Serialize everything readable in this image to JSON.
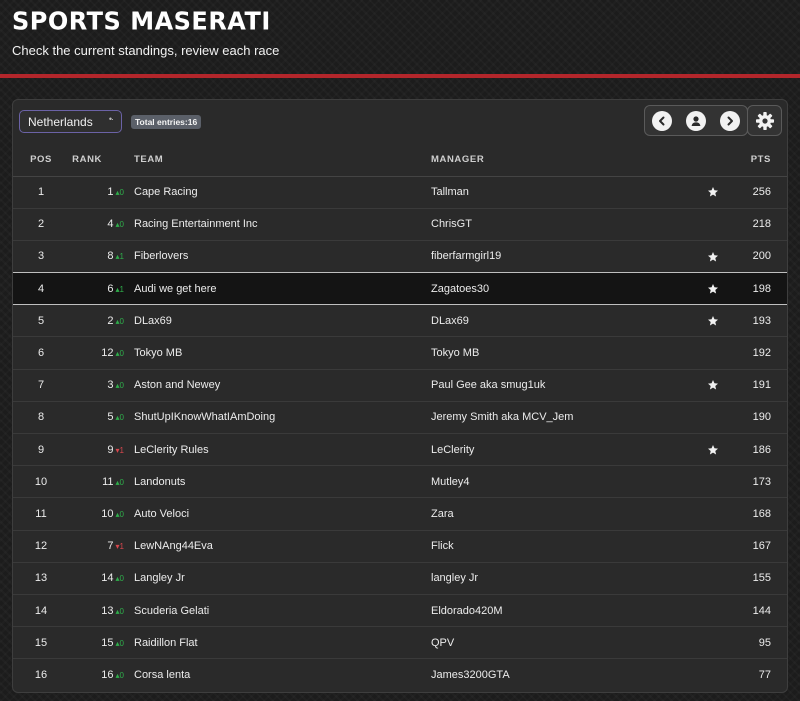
{
  "header": {
    "title": "SPORTS MASERATI",
    "subtitle": "Check the current standings, review each race"
  },
  "toolbar": {
    "country": "Netherlands",
    "total_entries_label": "Total entries:16"
  },
  "columns": {
    "pos": "POS",
    "rank": "RANK",
    "team": "TEAM",
    "manager": "MANAGER",
    "pts": "PTS"
  },
  "colors": {
    "accent_red": "#b3262b",
    "select_border": "#6b62a6",
    "up": "#2fae4b",
    "down": "#d8474d"
  },
  "rows": [
    {
      "pos": "1",
      "rank": "1",
      "delta": "0",
      "dir": "up",
      "team": "Cape Racing",
      "manager": "Tallman",
      "starred": true,
      "pts": "256"
    },
    {
      "pos": "2",
      "rank": "4",
      "delta": "0",
      "dir": "up",
      "team": "Racing Entertainment Inc",
      "manager": "ChrisGT",
      "starred": false,
      "pts": "218"
    },
    {
      "pos": "3",
      "rank": "8",
      "delta": "1",
      "dir": "up",
      "team": "Fiberlovers",
      "manager": "fiberfarmgirl19",
      "starred": true,
      "pts": "200"
    },
    {
      "pos": "4",
      "rank": "6",
      "delta": "1",
      "dir": "up",
      "team": "Audi we get here",
      "manager": "Zagatoes30",
      "starred": true,
      "pts": "198",
      "selected": true
    },
    {
      "pos": "5",
      "rank": "2",
      "delta": "0",
      "dir": "up",
      "team": "DLax69",
      "manager": "DLax69",
      "starred": true,
      "pts": "193"
    },
    {
      "pos": "6",
      "rank": "12",
      "delta": "0",
      "dir": "up",
      "team": "Tokyo MB",
      "manager": "Tokyo MB",
      "starred": false,
      "pts": "192"
    },
    {
      "pos": "7",
      "rank": "3",
      "delta": "0",
      "dir": "up",
      "team": "Aston and Newey",
      "manager": "Paul Gee aka smug1uk",
      "starred": true,
      "pts": "191"
    },
    {
      "pos": "8",
      "rank": "5",
      "delta": "0",
      "dir": "up",
      "team": "ShutUpIKnowWhatIAmDoing",
      "manager": "Jeremy Smith aka MCV_Jem",
      "starred": false,
      "pts": "190"
    },
    {
      "pos": "9",
      "rank": "9",
      "delta": "1",
      "dir": "down",
      "team": "LeClerity Rules",
      "manager": "LeClerity",
      "starred": true,
      "pts": "186"
    },
    {
      "pos": "10",
      "rank": "11",
      "delta": "0",
      "dir": "up",
      "team": "Landonuts",
      "manager": "Mutley4",
      "starred": false,
      "pts": "173"
    },
    {
      "pos": "11",
      "rank": "10",
      "delta": "0",
      "dir": "up",
      "team": "Auto Veloci",
      "manager": "Zara",
      "starred": false,
      "pts": "168"
    },
    {
      "pos": "12",
      "rank": "7",
      "delta": "1",
      "dir": "down",
      "team": "LewNAng44Eva",
      "manager": "Flick",
      "starred": false,
      "pts": "167"
    },
    {
      "pos": "13",
      "rank": "14",
      "delta": "0",
      "dir": "up",
      "team": "Langley Jr",
      "manager": "langley Jr",
      "starred": false,
      "pts": "155"
    },
    {
      "pos": "14",
      "rank": "13",
      "delta": "0",
      "dir": "up",
      "team": "Scuderia Gelati",
      "manager": "Eldorado420M",
      "starred": false,
      "pts": "144"
    },
    {
      "pos": "15",
      "rank": "15",
      "delta": "0",
      "dir": "up",
      "team": "Raidillon Flat",
      "manager": "QPV",
      "starred": false,
      "pts": "95"
    },
    {
      "pos": "16",
      "rank": "16",
      "delta": "0",
      "dir": "up",
      "team": "Corsa lenta",
      "manager": "James3200GTA",
      "starred": false,
      "pts": "77"
    }
  ]
}
